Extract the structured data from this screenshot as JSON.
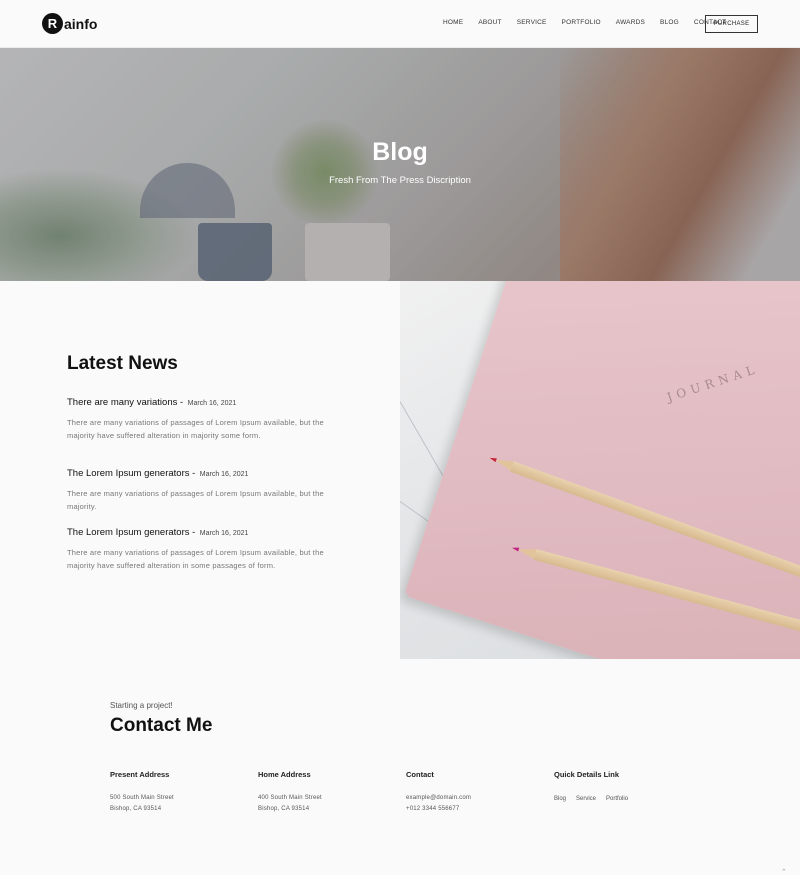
{
  "header": {
    "logo_letter": "R",
    "logo_text": "ainfo",
    "nav": [
      "HOME",
      "ABOUT",
      "SERVICE",
      "PORTFOLIO",
      "AWARDS",
      "BLOG",
      "CONTACT"
    ],
    "purchase_label": "PURCHASE"
  },
  "hero": {
    "title": "Blog",
    "subtitle": "Fresh From The Press Discription"
  },
  "news": {
    "title": "Latest News",
    "items": [
      {
        "heading": "There are many variations -",
        "date": "March 16, 2021",
        "desc": "There are many variations of passages of Lorem Ipsum available, but the majority have suffered alteration in majority some form."
      },
      {
        "heading": "The Lorem Ipsum generators -",
        "date": "March 16, 2021",
        "desc": "There are many variations of passages of Lorem Ipsum available, but the majority."
      },
      {
        "heading": "The Lorem Ipsum generators -",
        "date": "March 16, 2021",
        "desc": "There are many variations of passages of Lorem Ipsum available, but the majority have suffered alteration in some passages of form."
      }
    ]
  },
  "journal": {
    "cover_word": "JOURNAL"
  },
  "contact": {
    "kicker": "Starting a project!",
    "title": "Contact Me",
    "columns": [
      {
        "head": "Present Address",
        "lines": [
          "500 South Main Street",
          "Bishop, CA 93514"
        ]
      },
      {
        "head": "Home Address",
        "lines": [
          "400 South Main Street",
          "Bishop, CA 93514"
        ]
      },
      {
        "head": "Contact",
        "lines": [
          "example@domain.com",
          "+012 3344 556677"
        ]
      }
    ],
    "quick": {
      "head": "Quick Details Link",
      "links": [
        "Blog",
        "Service",
        "Portfolio"
      ]
    },
    "scroll_top_glyph": "⌃"
  }
}
